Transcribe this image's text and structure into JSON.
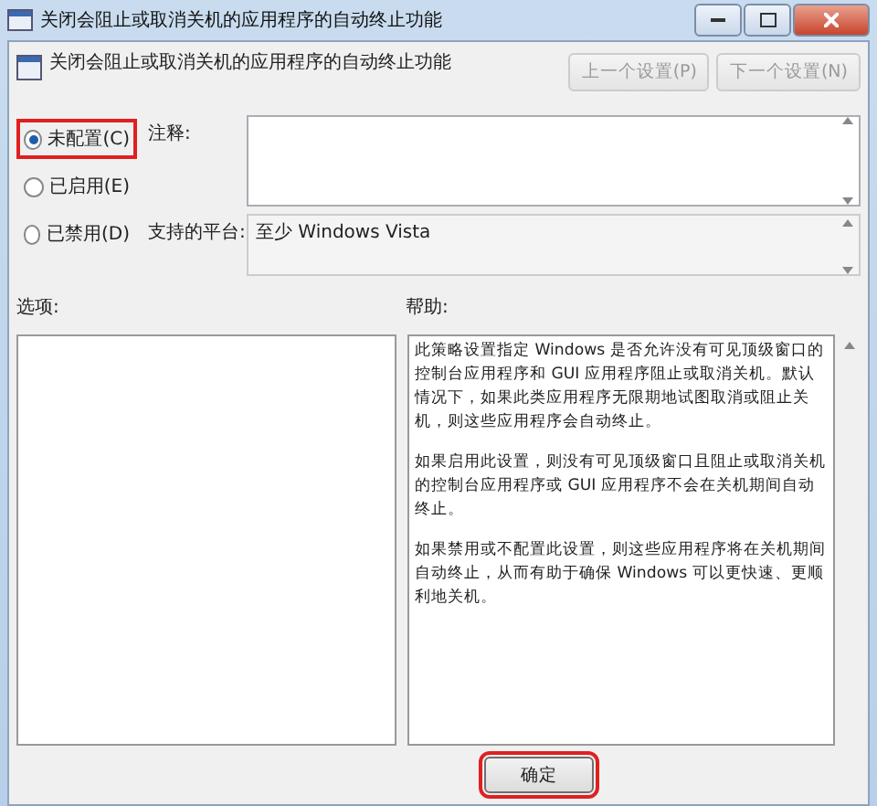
{
  "window": {
    "title": "关闭会阻止或取消关机的应用程序的自动终止功能"
  },
  "header": {
    "title": "关闭会阻止或取消关机的应用程序的自动终止功能",
    "buttons": [
      {
        "label": "上一个设置(P)",
        "disabled": true
      },
      {
        "label": "下一个设置(N)",
        "disabled": true
      }
    ]
  },
  "options": [
    {
      "label": "未配置(C)",
      "selected": true,
      "highlighted": true
    },
    {
      "label": "已启用(E)",
      "selected": false,
      "highlighted": false
    },
    {
      "label": "已禁用(D)",
      "selected": false,
      "highlighted": false
    }
  ],
  "comment": {
    "label": "注释:"
  },
  "platform": {
    "label": "支持的平台:",
    "value": "至少 Windows Vista"
  },
  "options_panel": {
    "label": "选项:"
  },
  "help": {
    "label": "帮助:",
    "paragraphs": [
      "此策略设置指定 Windows 是否允许没有可见顶级窗口的控制台应用程序和 GUI 应用程序阻止或取消关机。默认情况下，如果此类应用程序无限期地试图取消或阻止关机，则这些应用程序会自动终止。",
      "如果启用此设置，则没有可见顶级窗口且阻止或取消关机的控制台应用程序或 GUI 应用程序不会在关机期间自动终止。",
      "如果禁用或不配置此设置，则这些应用程序将在关机期间自动终止，从而有助于确保 Windows 可以更快速、更顺利地关机。"
    ]
  },
  "footer": {
    "buttons": [
      {
        "label": "确定",
        "highlighted": true
      }
    ]
  }
}
